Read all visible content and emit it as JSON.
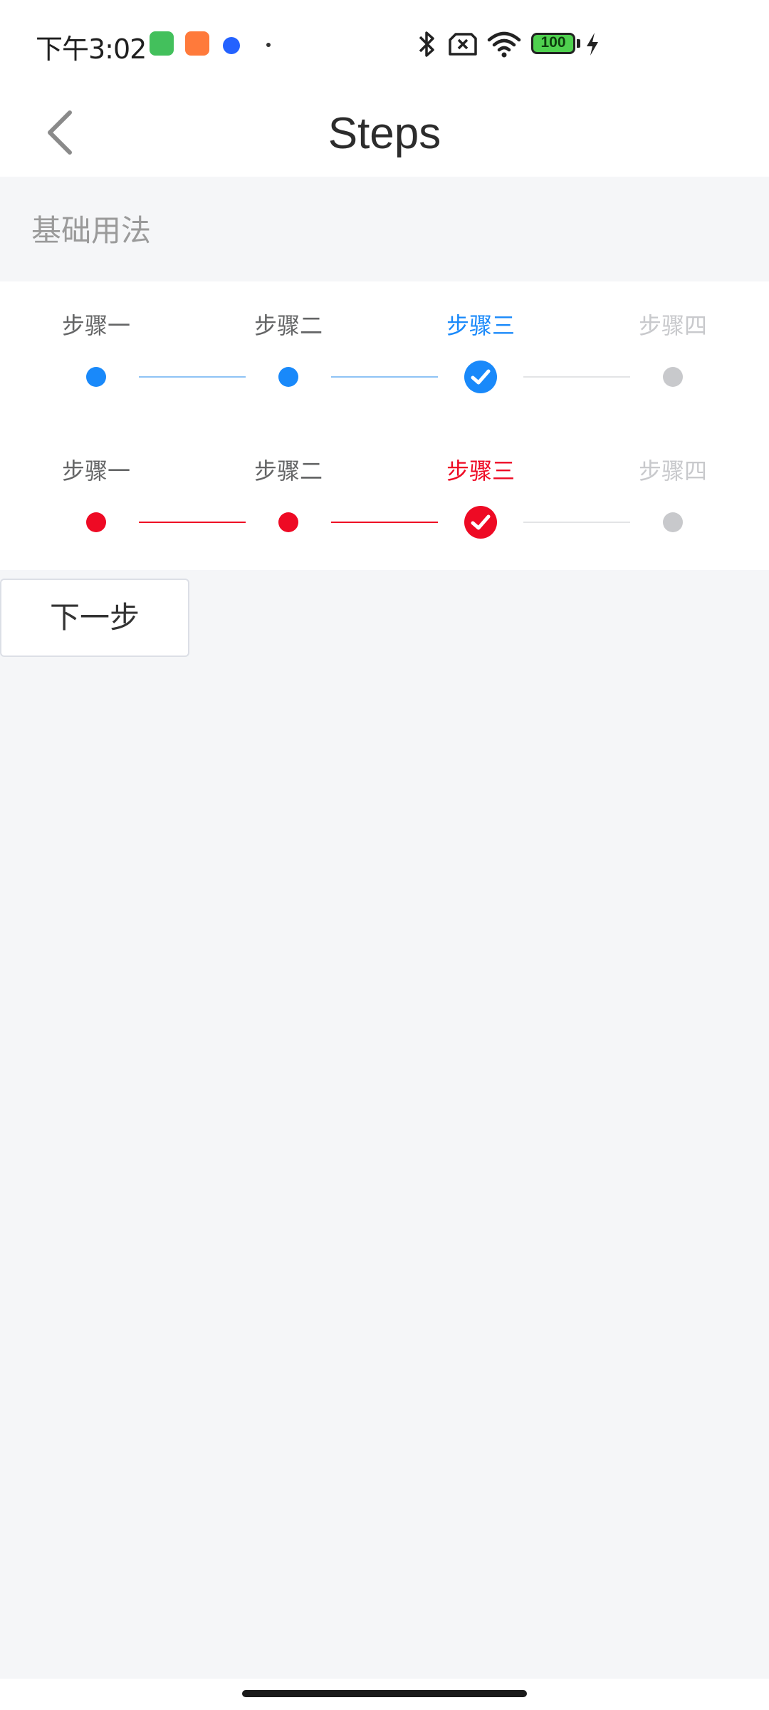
{
  "status_bar": {
    "time": "下午3:02",
    "battery_level": "100",
    "icons": [
      "cat-app-icon",
      "shop-app-icon",
      "message-app-icon",
      "notification-dot-icon",
      "bluetooth-icon",
      "no-sim-icon",
      "wifi-icon",
      "battery-icon",
      "charging-icon"
    ]
  },
  "nav": {
    "title": "Steps",
    "back_icon": "chevron-left-icon"
  },
  "section": {
    "title": "基础用法"
  },
  "steps_blue": {
    "color_active": "#1989fa",
    "color_inactive": "#c8c9cc",
    "active_index": 2,
    "items": [
      {
        "label": "步骤一"
      },
      {
        "label": "步骤二"
      },
      {
        "label": "步骤三"
      },
      {
        "label": "步骤四"
      }
    ]
  },
  "steps_red": {
    "color_active": "#ee0a24",
    "color_inactive": "#c8c9cc",
    "active_index": 2,
    "items": [
      {
        "label": "步骤一"
      },
      {
        "label": "步骤二"
      },
      {
        "label": "步骤三"
      },
      {
        "label": "步骤四"
      }
    ]
  },
  "next_button": {
    "label": "下一步"
  }
}
